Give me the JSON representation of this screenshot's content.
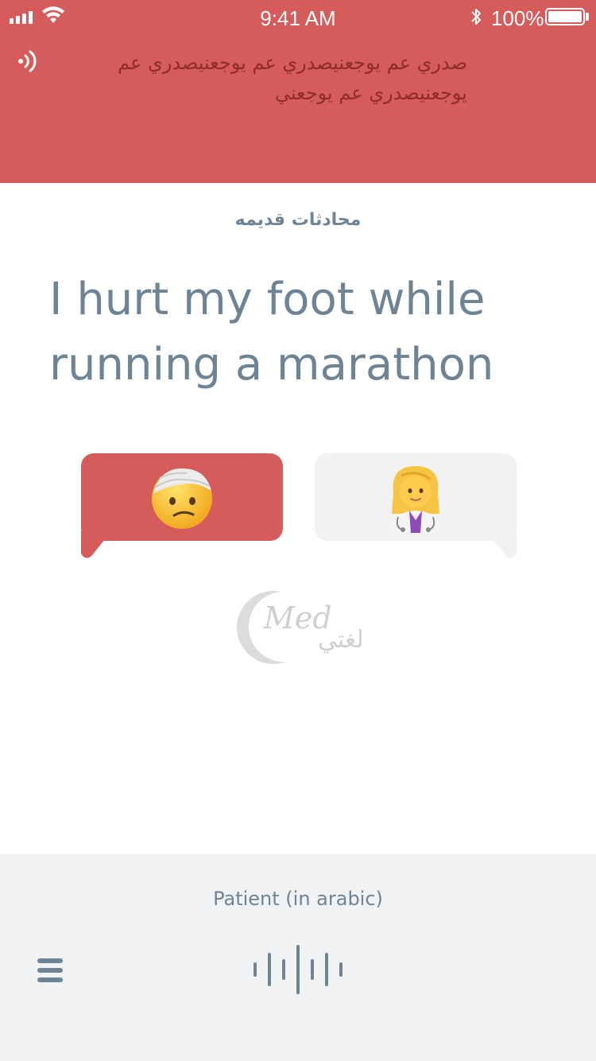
{
  "status_bar": {
    "time": "9:41 AM",
    "battery": "100%",
    "icons": [
      "signal-icon",
      "wifi-icon",
      "bluetooth-icon",
      "battery-icon"
    ]
  },
  "header": {
    "speaker_icon": "speaker-waves-icon",
    "translation": "صدري عم يوجعنيصدري عم يوجعنيصدري عم يوجعنيصدري عم يوجعني"
  },
  "main": {
    "section_title": "محادثات قديمه",
    "phrase": "I hurt my foot while running a marathon",
    "patient_bubble": {
      "icon": "injured-face-emoji",
      "emoji": "🤕"
    },
    "doctor_bubble": {
      "icon": "doctor-emoji",
      "emoji": "👩‍⚕️"
    }
  },
  "logo": {
    "latin": "Med",
    "arabic": "لغتي"
  },
  "footer": {
    "role_label": "Patient (in arabic)",
    "menu_icon": "hamburger-menu-icon",
    "mic_icon": "voice-waveform-icon"
  },
  "colors": {
    "accent": "#D65B5B",
    "text_muted": "#6E8494",
    "translation_text": "#8E2C2C",
    "footer_bg": "#F0F2F4",
    "bubble_gray": "#F1F2F4"
  }
}
